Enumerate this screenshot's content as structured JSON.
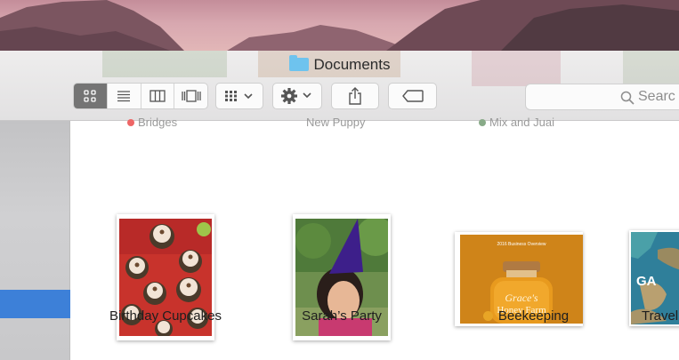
{
  "window": {
    "title": "Documents",
    "folder_icon": "folder-icon",
    "accent_color": "#3d80d8"
  },
  "toolbar": {
    "view_buttons": [
      "icon-view",
      "list-view",
      "column-view",
      "cover-flow-view"
    ],
    "active_view": "icon-view",
    "arrange_icon": "arrange-icon",
    "action_icon": "gear-icon",
    "share_icon": "share-icon",
    "tag_icon": "tag-icon",
    "search_placeholder": "Searc"
  },
  "partial_top_labels": [
    "Bridges",
    "New Puppy",
    "Mix and Juai"
  ],
  "files": [
    {
      "name": "Birthday Cupcakes",
      "tag_color": null
    },
    {
      "name": "Sarah’s Party",
      "tag_color": null
    },
    {
      "name": "Beekeeping",
      "tag_color": "#e8a526"
    },
    {
      "name": "Travel",
      "tag_color": null
    }
  ],
  "beekeeping_cover": {
    "header": "2016 Business Overview",
    "title_line1": "Grace's",
    "title_line2": "Honey Farm"
  },
  "travel_cover": {
    "text": "GA"
  }
}
